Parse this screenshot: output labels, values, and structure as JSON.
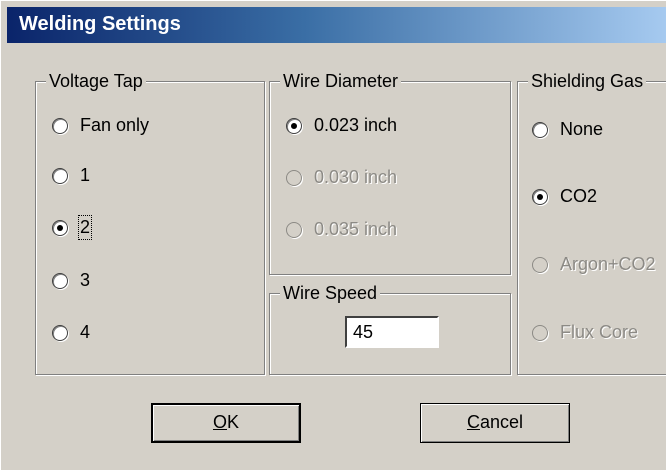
{
  "window": {
    "title": "Welding Settings"
  },
  "voltage_tap": {
    "title": "Voltage Tap",
    "options": [
      {
        "label": "Fan only",
        "checked": false
      },
      {
        "label": "1",
        "checked": false
      },
      {
        "label": "2",
        "checked": true
      },
      {
        "label": "3",
        "checked": false
      },
      {
        "label": "4",
        "checked": false
      }
    ]
  },
  "wire_diameter": {
    "title": "Wire Diameter",
    "options": [
      {
        "label": "0.023 inch",
        "checked": true,
        "disabled": false
      },
      {
        "label": "0.030 inch",
        "checked": false,
        "disabled": true
      },
      {
        "label": "0.035 inch",
        "checked": false,
        "disabled": true
      }
    ]
  },
  "wire_speed": {
    "title": "Wire Speed",
    "value": "45"
  },
  "shielding_gas": {
    "title": "Shielding Gas",
    "options": [
      {
        "label": "None",
        "checked": false,
        "disabled": false
      },
      {
        "label": "CO2",
        "checked": true,
        "disabled": false
      },
      {
        "label": "Argon+CO2",
        "checked": false,
        "disabled": true
      },
      {
        "label": "Flux Core",
        "checked": false,
        "disabled": true
      }
    ]
  },
  "buttons": {
    "ok_mnemonic": "O",
    "ok_rest": "K",
    "cancel_mnemonic": "C",
    "cancel_rest": "ancel"
  }
}
